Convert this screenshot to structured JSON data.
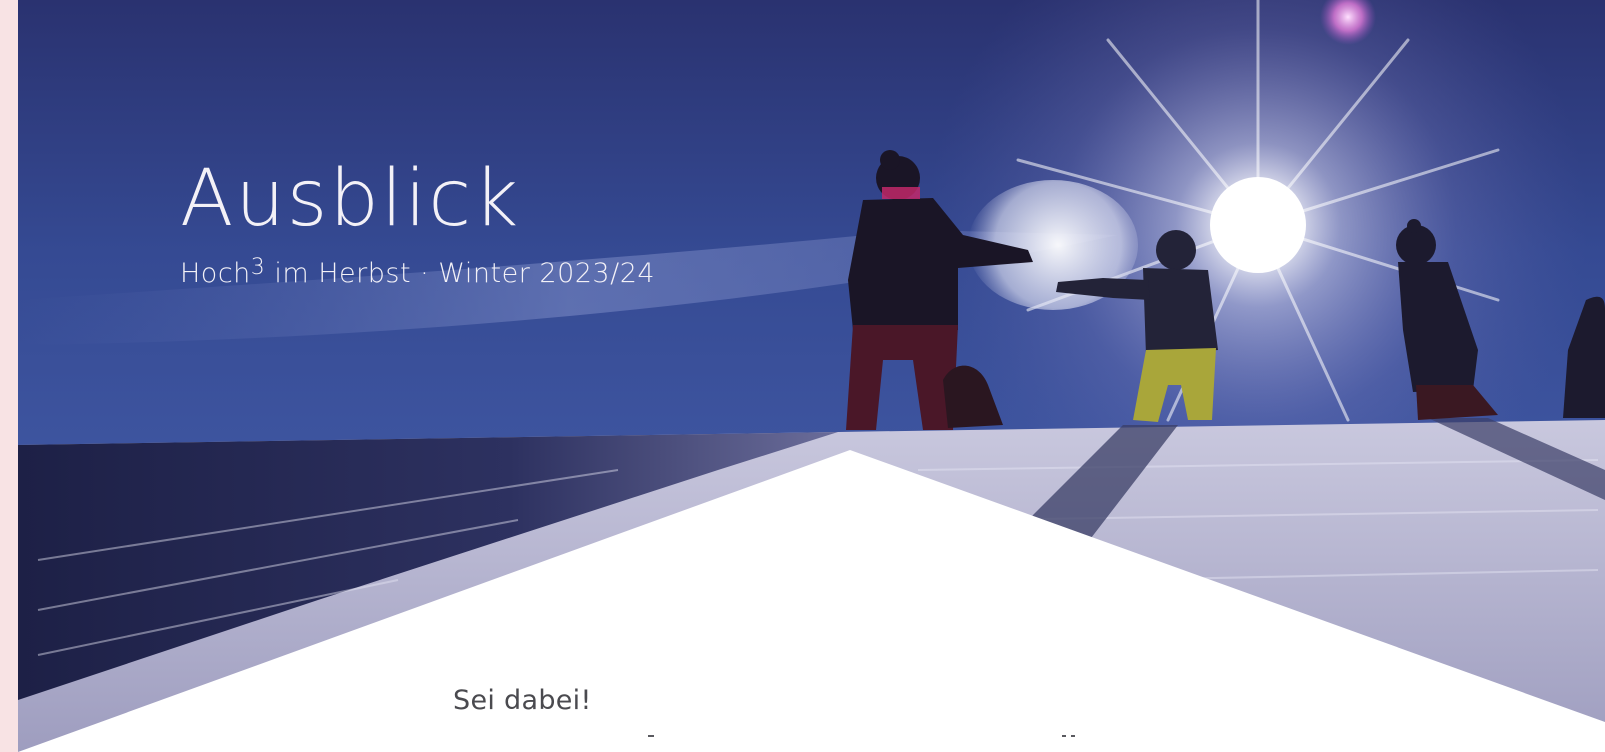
{
  "hero": {
    "title": "Ausblick",
    "subtitle_prefix": "Hoch",
    "subtitle_superscript": "3",
    "subtitle_suffix": " im Herbst · Winter 2023/24"
  },
  "body": {
    "intro": "Sei dabei!"
  },
  "colors": {
    "side_strip": "#f8e3e4",
    "sky_top": "#2c3574",
    "sky_bottom": "#3b4f99",
    "snow_light": "#e9e8f2",
    "snow_shadow": "#3a3d66",
    "title_text": "#f3f1f7",
    "body_text": "#4a4a4f"
  }
}
